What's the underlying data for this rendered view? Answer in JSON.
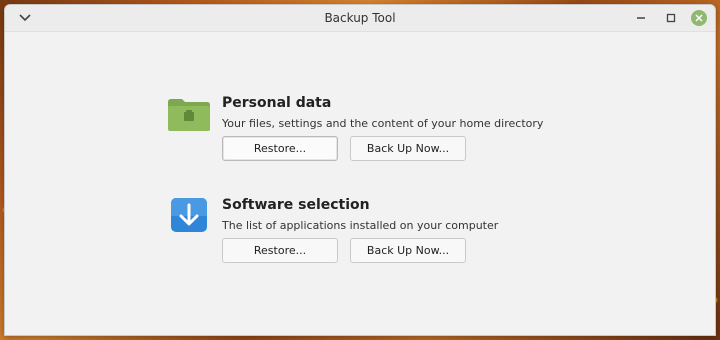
{
  "window": {
    "title": "Backup Tool",
    "menu_icon": "chevron-down-icon",
    "controls": {
      "minimize_icon": "minimize-icon",
      "maximize_icon": "maximize-icon",
      "close_icon": "close-icon"
    },
    "colors": {
      "close_button": "#8fb971",
      "window_bg": "#f2f2f2"
    }
  },
  "sections": {
    "personal": {
      "icon": "folder-icon",
      "heading": "Personal data",
      "description": "Your files, settings and the content of your home directory",
      "restore_label": "Restore...",
      "backup_label": "Back Up Now..."
    },
    "software": {
      "icon": "download-arrow-icon",
      "heading": "Software selection",
      "description": "The list of applications installed on your computer",
      "restore_label": "Restore...",
      "backup_label": "Back Up Now..."
    }
  },
  "glyphs": {
    "menu": "⌄",
    "minimize": "—",
    "maximize": "□",
    "close": "✕"
  }
}
